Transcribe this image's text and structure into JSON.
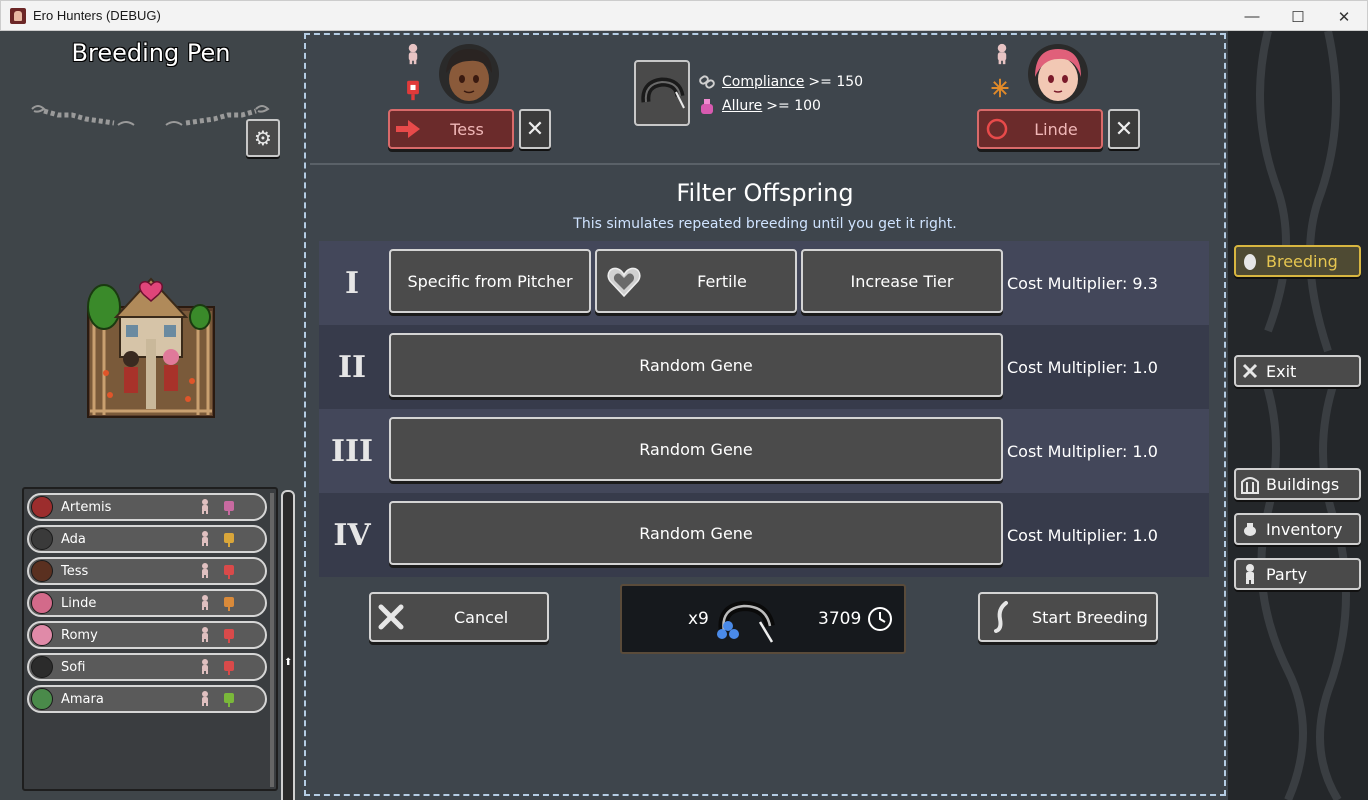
{
  "window": {
    "title": "Ero Hunters (DEBUG)",
    "minimize": "—",
    "maximize": "☐",
    "close": "✕"
  },
  "left": {
    "title": "Breeding Pen",
    "settings_icon": "⚙",
    "characters": [
      {
        "name": "Artemis",
        "avatar_color": "#9c2d2d",
        "tag_color": "#c86aa0"
      },
      {
        "name": "Ada",
        "avatar_color": "#3a3a3a",
        "tag_color": "#d9a63a"
      },
      {
        "name": "Tess",
        "avatar_color": "#5a3020",
        "tag_color": "#d94a4a"
      },
      {
        "name": "Linde",
        "avatar_color": "#d36a8a",
        "tag_color": "#d98a3a"
      },
      {
        "name": "Romy",
        "avatar_color": "#e08aa8",
        "tag_color": "#d94a4a"
      },
      {
        "name": "Sofi",
        "avatar_color": "#2b2b2b",
        "tag_color": "#d94a4a"
      },
      {
        "name": "Amara",
        "avatar_color": "#4a8a4a",
        "tag_color": "#7ab83a"
      }
    ],
    "scroll_icon": "⬆"
  },
  "parents": {
    "pitcher": {
      "name": "Tess",
      "icon": "arrow-right-icon"
    },
    "catcher": {
      "name": "Linde",
      "icon": "circle-icon"
    },
    "remove_icon": "✕"
  },
  "requirements": [
    {
      "name": "Compliance",
      "value": ">= 150"
    },
    {
      "name": "Allure",
      "value": ">= 100"
    }
  ],
  "filter": {
    "title": "Filter Offspring",
    "subtitle": "This simulates repeated breeding until you get it right.",
    "rows": [
      {
        "numeral": "I",
        "buttons": [
          "Specific from Pitcher",
          "Fertile",
          "Increase Tier"
        ],
        "cost": "Cost Multiplier: 9.3"
      },
      {
        "numeral": "II",
        "buttons": [
          "Random Gene"
        ],
        "cost": "Cost Multiplier: 1.0"
      },
      {
        "numeral": "III",
        "buttons": [
          "Random Gene"
        ],
        "cost": "Cost Multiplier: 1.0"
      },
      {
        "numeral": "IV",
        "buttons": [
          "Random Gene"
        ],
        "cost": "Cost Multiplier: 1.0"
      }
    ]
  },
  "actions": {
    "cancel": "Cancel",
    "start": "Start Breeding",
    "item_count": "x9",
    "time_cost": "3709"
  },
  "nav": {
    "breeding": "Breeding",
    "exit": "Exit",
    "buildings": "Buildings",
    "inventory": "Inventory",
    "party": "Party"
  }
}
